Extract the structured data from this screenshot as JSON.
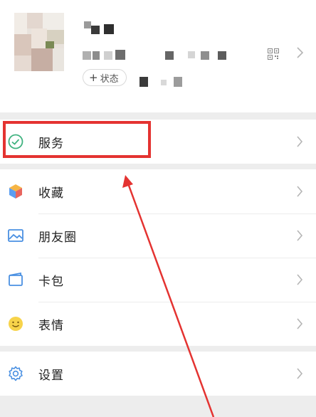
{
  "profile": {
    "status_plus": "+",
    "status_label": "状态"
  },
  "menu": {
    "services": {
      "label": "服务",
      "icon": "services-icon"
    },
    "favorites": {
      "label": "收藏",
      "icon": "favorites-cube-icon"
    },
    "moments": {
      "label": "朋友圈",
      "icon": "moments-image-icon"
    },
    "cards": {
      "label": "卡包",
      "icon": "card-wallet-icon"
    },
    "stickers": {
      "label": "表情",
      "icon": "sticker-smiley-icon"
    },
    "settings": {
      "label": "设置",
      "icon": "settings-gear-icon"
    }
  },
  "colors": {
    "highlight": "#e43331",
    "services_green": "#3fb27f",
    "background": "#ededed"
  }
}
